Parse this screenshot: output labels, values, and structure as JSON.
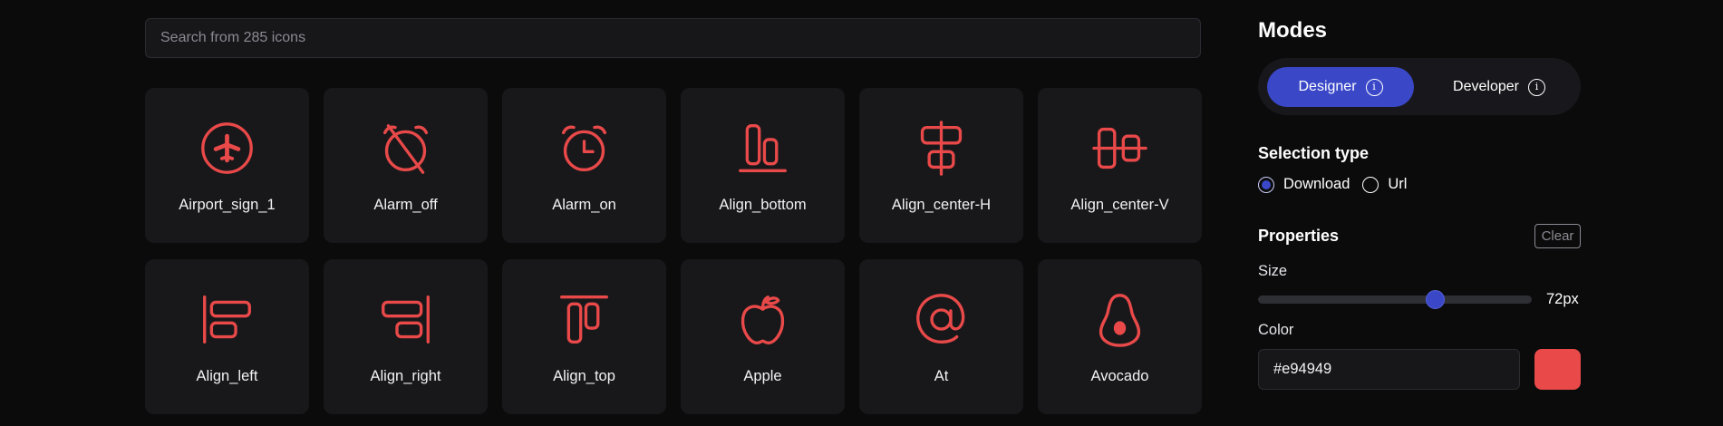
{
  "search": {
    "placeholder": "Search from 285 icons"
  },
  "icons": [
    {
      "name": "airplane-circle-icon",
      "label": "Airport_sign_1"
    },
    {
      "name": "alarm-off-icon",
      "label": "Alarm_off"
    },
    {
      "name": "alarm-on-icon",
      "label": "Alarm_on"
    },
    {
      "name": "align-bottom-icon",
      "label": "Align_bottom"
    },
    {
      "name": "align-center-h-icon",
      "label": "Align_center-H"
    },
    {
      "name": "align-center-v-icon",
      "label": "Align_center-V"
    },
    {
      "name": "align-left-icon",
      "label": "Align_left"
    },
    {
      "name": "align-right-icon",
      "label": "Align_right"
    },
    {
      "name": "align-top-icon",
      "label": "Align_top"
    },
    {
      "name": "apple-icon",
      "label": "Apple"
    },
    {
      "name": "at-sign-icon",
      "label": "At"
    },
    {
      "name": "avocado-icon",
      "label": "Avocado"
    }
  ],
  "panel": {
    "modes_title": "Modes",
    "modes": [
      {
        "label": "Designer",
        "active": true
      },
      {
        "label": "Developer",
        "active": false
      }
    ],
    "info_glyph": "i",
    "selection_title": "Selection type",
    "selection_options": [
      {
        "label": "Download",
        "selected": true
      },
      {
        "label": "Url",
        "selected": false
      }
    ],
    "properties_title": "Properties",
    "clear_label": "Clear",
    "size_label": "Size",
    "size_value": "72px",
    "size_fraction": 0.66,
    "color_label": "Color",
    "color_value": "#e94949"
  },
  "colors": {
    "icon": "#e94949",
    "accent": "#3a48c8"
  }
}
